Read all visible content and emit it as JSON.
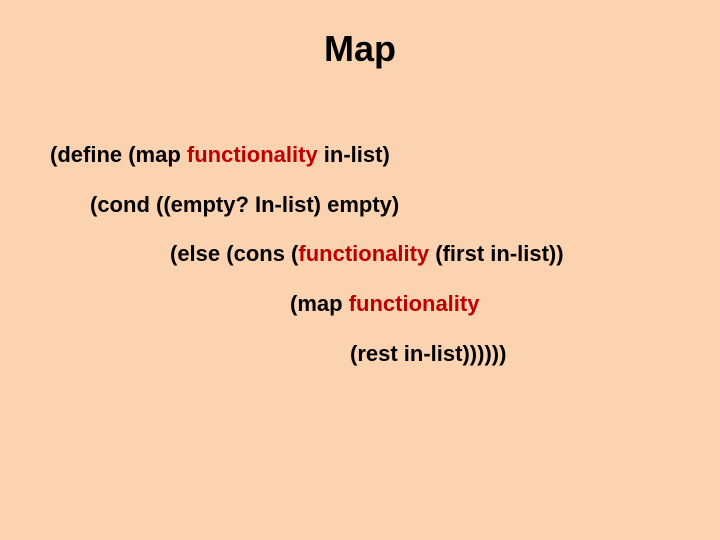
{
  "title": "Map",
  "code": {
    "l1a": "(define (map ",
    "l1b": "functionality",
    "l1c": " in-list)",
    "l2": "(cond ((empty?  In-list) empty)",
    "l3a": "(else (cons (",
    "l3b": "functionality",
    "l3c": " (first in-list))",
    "l4a": "(map ",
    "l4b": "functionality",
    "l5": "(rest in-list))))))"
  }
}
